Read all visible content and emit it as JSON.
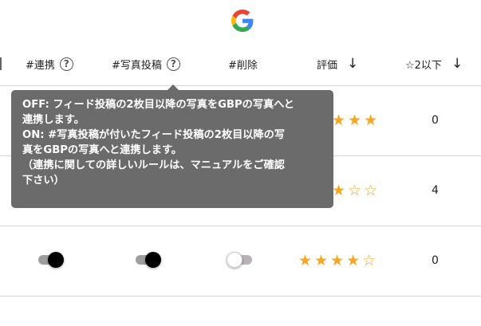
{
  "header": {
    "logo_icon": "google-g-icon",
    "col_link": "#連携",
    "col_photo_post": "#写真投稿",
    "col_delete": "#削除",
    "col_rating": "評価",
    "col_low_rating": "☆2以下",
    "help_glyph": "?",
    "sort_glyph": "↓"
  },
  "tooltip": {
    "text": "OFF: フィード投稿の2枚目以降の写真をGBPの写真へと\n連携します。\nON: #写真投稿が付いたフィード投稿の2枚目以降の写\n真をGBPの写真へと連携します。\n（連携に関しての詳しいルールは、マニュアルをご確認\n下さい）"
  },
  "rows": [
    {
      "rating_stars": "★★★",
      "rating_value": 5,
      "low_rating_count": "0"
    },
    {
      "rating_stars": "★☆☆",
      "rating_value": 3,
      "low_rating_count": "4"
    },
    {
      "stars_display": "★★★★☆",
      "rating_value": 4,
      "low_rating_count": "0",
      "toggle_link": true,
      "toggle_photo_post": true,
      "toggle_delete": false
    }
  ],
  "colors": {
    "star": "#f5a623",
    "tooltip_bg": "#6b6b6b"
  }
}
